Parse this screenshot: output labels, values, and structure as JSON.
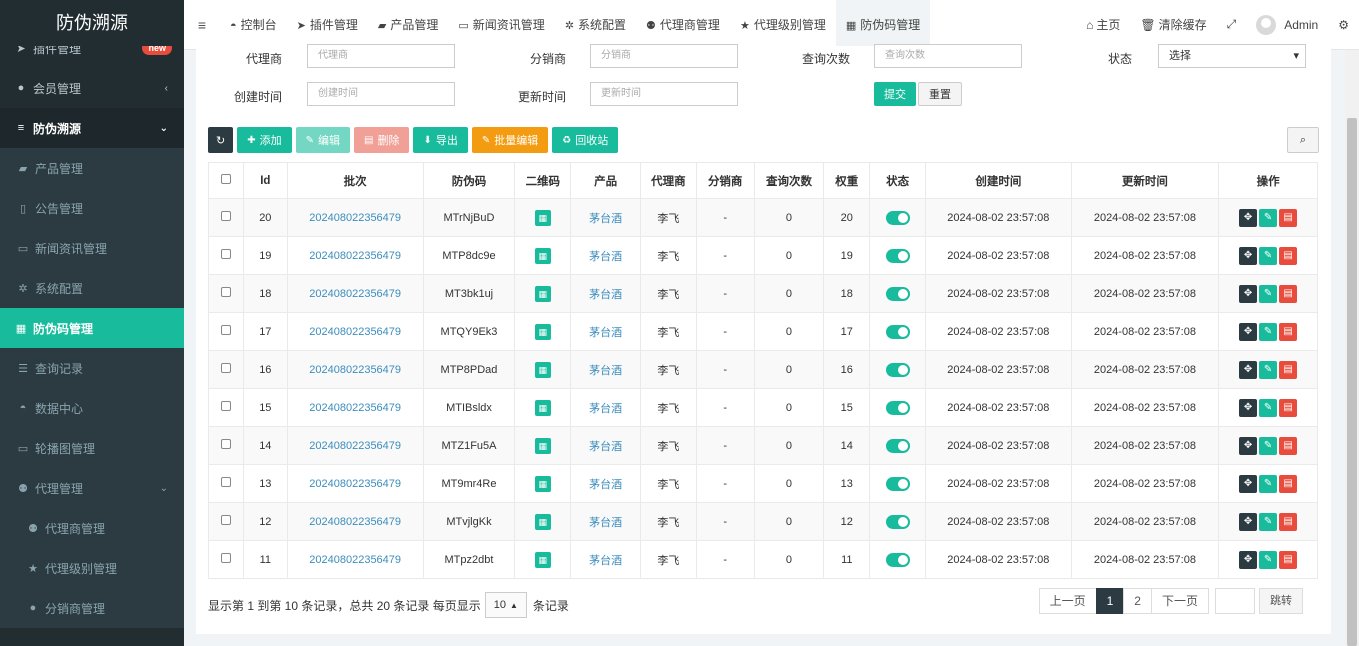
{
  "sidebar": {
    "logo": "防伪溯源",
    "items": [
      {
        "label": "插件管理",
        "badge": "new"
      },
      {
        "label": "会员管理"
      },
      {
        "label": "防伪溯源"
      },
      {
        "label": "产品管理"
      },
      {
        "label": "公告管理"
      },
      {
        "label": "新闻资讯管理"
      },
      {
        "label": "系统配置"
      },
      {
        "label": "防伪码管理"
      },
      {
        "label": "查询记录"
      },
      {
        "label": "数据中心"
      },
      {
        "label": "轮播图管理"
      },
      {
        "label": "代理管理"
      },
      {
        "label": "代理商管理"
      },
      {
        "label": "代理级别管理"
      },
      {
        "label": "分销商管理"
      }
    ]
  },
  "topnav": {
    "tabs": [
      "控制台",
      "插件管理",
      "产品管理",
      "新闻资讯管理",
      "系统配置",
      "代理商管理",
      "代理级别管理",
      "防伪码管理"
    ],
    "home": "主页",
    "clear_cache": "清除缓存",
    "user": "Admin"
  },
  "filters": {
    "agent_label": "代理商",
    "agent_placeholder": "代理商",
    "distributor_label": "分销商",
    "distributor_placeholder": "分销商",
    "query_count_label": "查询次数",
    "query_count_placeholder": "查询次数",
    "status_label": "状态",
    "status_value": "选择",
    "created_label": "创建时间",
    "created_placeholder": "创建时间",
    "updated_label": "更新时间",
    "updated_placeholder": "更新时间",
    "submit": "提交",
    "reset": "重置"
  },
  "toolbar": {
    "add": "添加",
    "edit": "编辑",
    "delete": "删除",
    "export": "导出",
    "batch_edit": "批量编辑",
    "recycle": "回收站"
  },
  "table": {
    "headers": [
      "Id",
      "批次",
      "防伪码",
      "二维码",
      "产品",
      "代理商",
      "分销商",
      "查询次数",
      "权重",
      "状态",
      "创建时间",
      "更新时间",
      "操作"
    ],
    "rows": [
      {
        "id": "20",
        "batch": "202408022356479",
        "code": "MTrNjBuD",
        "product": "茅台酒",
        "agent": "李飞",
        "distributor": "-",
        "queries": "0",
        "weight": "20",
        "created": "2024-08-02 23:57:08",
        "updated": "2024-08-02 23:57:08"
      },
      {
        "id": "19",
        "batch": "202408022356479",
        "code": "MTP8dc9e",
        "product": "茅台酒",
        "agent": "李飞",
        "distributor": "-",
        "queries": "0",
        "weight": "19",
        "created": "2024-08-02 23:57:08",
        "updated": "2024-08-02 23:57:08"
      },
      {
        "id": "18",
        "batch": "202408022356479",
        "code": "MT3bk1uj",
        "product": "茅台酒",
        "agent": "李飞",
        "distributor": "-",
        "queries": "0",
        "weight": "18",
        "created": "2024-08-02 23:57:08",
        "updated": "2024-08-02 23:57:08"
      },
      {
        "id": "17",
        "batch": "202408022356479",
        "code": "MTQY9Ek3",
        "product": "茅台酒",
        "agent": "李飞",
        "distributor": "-",
        "queries": "0",
        "weight": "17",
        "created": "2024-08-02 23:57:08",
        "updated": "2024-08-02 23:57:08"
      },
      {
        "id": "16",
        "batch": "202408022356479",
        "code": "MTP8PDad",
        "product": "茅台酒",
        "agent": "李飞",
        "distributor": "-",
        "queries": "0",
        "weight": "16",
        "created": "2024-08-02 23:57:08",
        "updated": "2024-08-02 23:57:08"
      },
      {
        "id": "15",
        "batch": "202408022356479",
        "code": "MTIBsldx",
        "product": "茅台酒",
        "agent": "李飞",
        "distributor": "-",
        "queries": "0",
        "weight": "15",
        "created": "2024-08-02 23:57:08",
        "updated": "2024-08-02 23:57:08"
      },
      {
        "id": "14",
        "batch": "202408022356479",
        "code": "MTZ1Fu5A",
        "product": "茅台酒",
        "agent": "李飞",
        "distributor": "-",
        "queries": "0",
        "weight": "14",
        "created": "2024-08-02 23:57:08",
        "updated": "2024-08-02 23:57:08"
      },
      {
        "id": "13",
        "batch": "202408022356479",
        "code": "MT9mr4Re",
        "product": "茅台酒",
        "agent": "李飞",
        "distributor": "-",
        "queries": "0",
        "weight": "13",
        "created": "2024-08-02 23:57:08",
        "updated": "2024-08-02 23:57:08"
      },
      {
        "id": "12",
        "batch": "202408022356479",
        "code": "MTvjlgKk",
        "product": "茅台酒",
        "agent": "李飞",
        "distributor": "-",
        "queries": "0",
        "weight": "12",
        "created": "2024-08-02 23:57:08",
        "updated": "2024-08-02 23:57:08"
      },
      {
        "id": "11",
        "batch": "202408022356479",
        "code": "MTpz2dbt",
        "product": "茅台酒",
        "agent": "李飞",
        "distributor": "-",
        "queries": "0",
        "weight": "11",
        "created": "2024-08-02 23:57:08",
        "updated": "2024-08-02 23:57:08"
      }
    ]
  },
  "footer": {
    "summary": "显示第 1 到第 10 条记录，总共 20 条记录 每页显示",
    "page_size": "10",
    "suffix": "条记录",
    "prev": "上一页",
    "page1": "1",
    "page2": "2",
    "next": "下一页",
    "jump": "跳转"
  },
  "colors": {
    "primary": "#18bc9c",
    "dark": "#2c3b41",
    "sidebar": "#222d32",
    "danger": "#e74c3c",
    "warning": "#f39c12",
    "link": "#3c8dbc"
  }
}
